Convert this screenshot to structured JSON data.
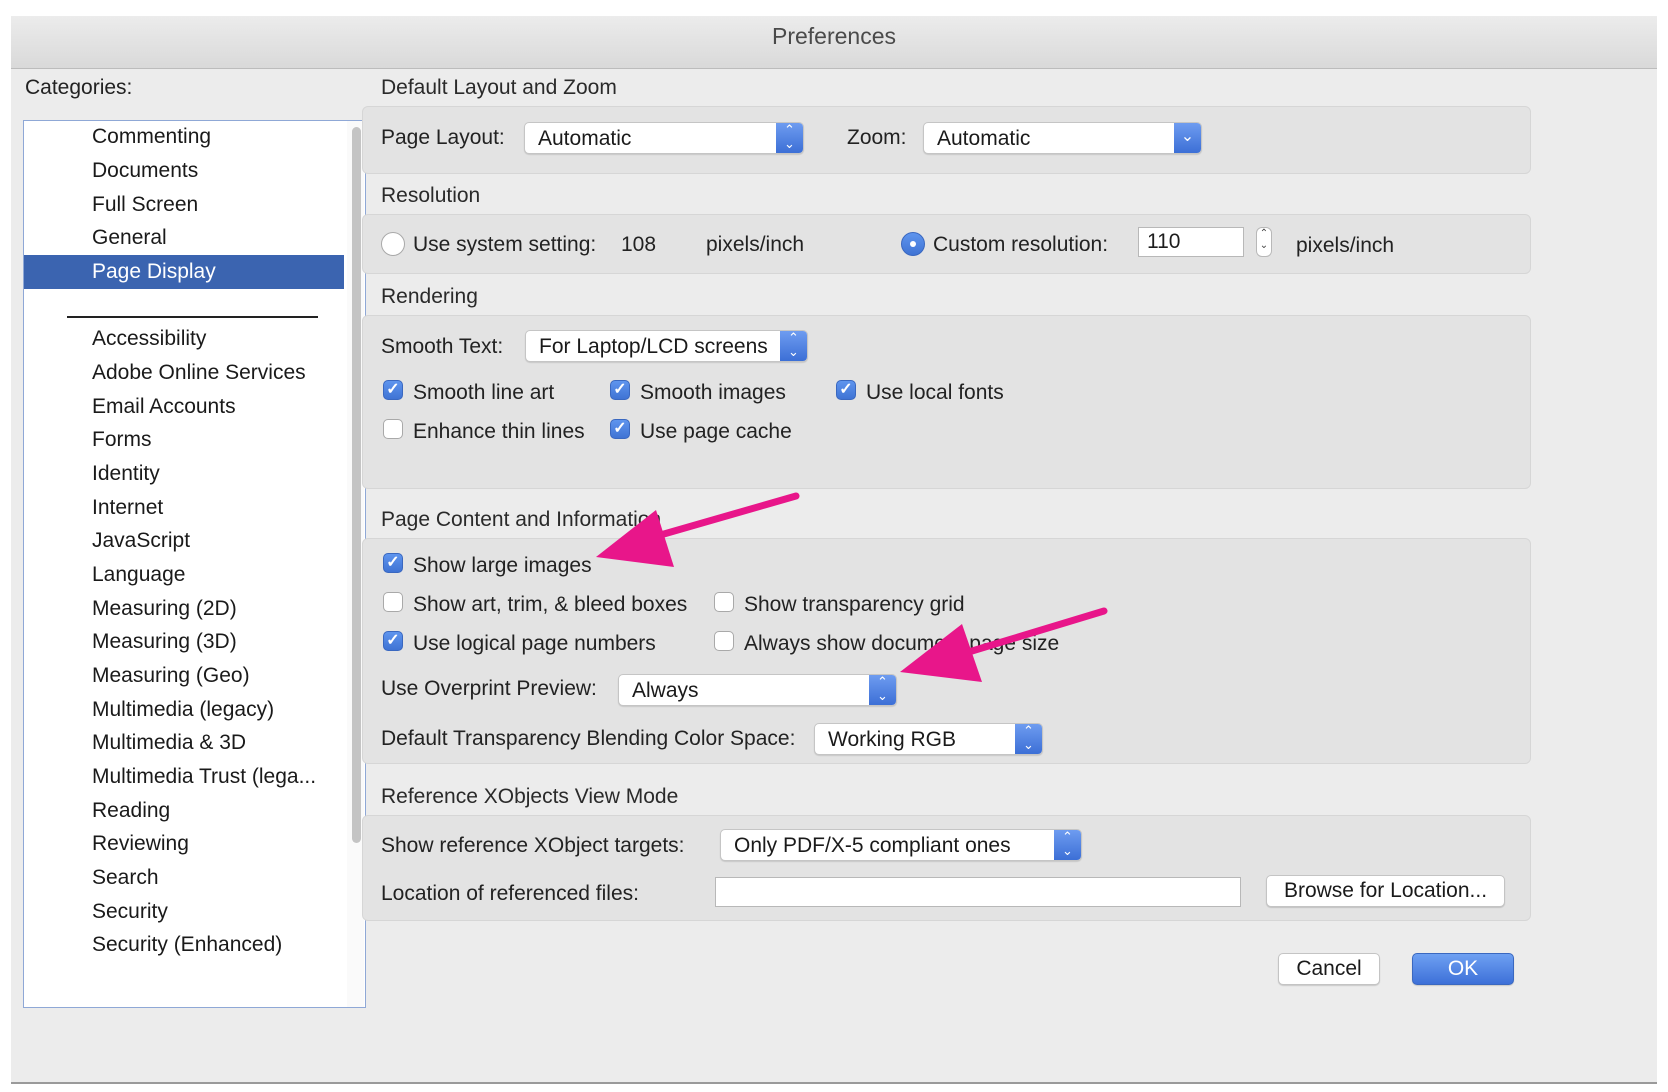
{
  "window": {
    "title": "Preferences"
  },
  "categories": {
    "label": "Categories:",
    "items_top": [
      "Commenting",
      "Documents",
      "Full Screen",
      "General",
      "Page Display"
    ],
    "items_bottom": [
      "Accessibility",
      "Adobe Online Services",
      "Email Accounts",
      "Forms",
      "Identity",
      "Internet",
      "JavaScript",
      "Language",
      "Measuring (2D)",
      "Measuring (3D)",
      "Measuring (Geo)",
      "Multimedia (legacy)",
      "Multimedia & 3D",
      "Multimedia Trust (lega...",
      "Reading",
      "Reviewing",
      "Search",
      "Security",
      "Security (Enhanced)"
    ],
    "selected": "Page Display"
  },
  "layout_zoom": {
    "title": "Default Layout and Zoom",
    "page_layout_label": "Page Layout:",
    "page_layout_value": "Automatic",
    "zoom_label": "Zoom:",
    "zoom_value": "Automatic"
  },
  "resolution": {
    "title": "Resolution",
    "system_label": "Use system setting:",
    "system_value": "108",
    "system_unit": "pixels/inch",
    "custom_label": "Custom resolution:",
    "custom_value": "110",
    "custom_unit": "pixels/inch",
    "selected": "custom"
  },
  "rendering": {
    "title": "Rendering",
    "smooth_text_label": "Smooth Text:",
    "smooth_text_value": "For Laptop/LCD screens",
    "smooth_line_art": "Smooth line art",
    "smooth_images": "Smooth images",
    "use_local_fonts": "Use local fonts",
    "enhance_thin_lines": "Enhance thin lines",
    "use_page_cache": "Use page cache",
    "checked": {
      "smooth_line_art": true,
      "smooth_images": true,
      "use_local_fonts": true,
      "enhance_thin_lines": false,
      "use_page_cache": true
    }
  },
  "page_content": {
    "title": "Page Content and Information",
    "show_large_images": "Show large images",
    "show_art_trim_bleed": "Show art, trim, & bleed boxes",
    "show_transparency_grid": "Show transparency grid",
    "use_logical_page_numbers": "Use logical page numbers",
    "always_show_doc_page_size": "Always show document page size",
    "overprint_label": "Use Overprint Preview:",
    "overprint_value": "Always",
    "blending_label": "Default Transparency Blending Color Space:",
    "blending_value": "Working RGB",
    "checked": {
      "show_large_images": true,
      "show_art_trim_bleed": false,
      "show_transparency_grid": false,
      "use_logical_page_numbers": true,
      "always_show_doc_page_size": false
    }
  },
  "xobjects": {
    "title": "Reference XObjects View Mode",
    "targets_label": "Show reference XObject targets:",
    "targets_value": "Only PDF/X-5 compliant ones",
    "location_label": "Location of referenced files:",
    "location_value": "",
    "browse_label": "Browse for Location..."
  },
  "buttons": {
    "cancel": "Cancel",
    "ok": "OK"
  },
  "colors": {
    "accent": "#3b64b0",
    "annotation_arrow": "#e8168a"
  }
}
